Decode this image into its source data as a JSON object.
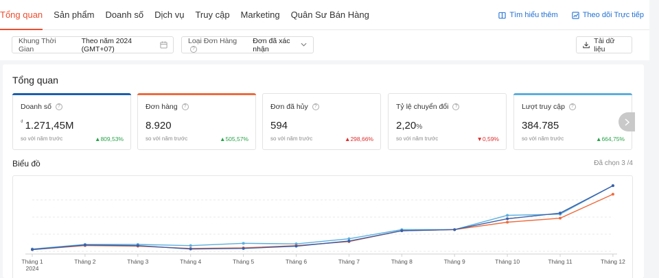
{
  "nav": {
    "tabs": [
      "Tổng quan",
      "Sản phẩm",
      "Doanh số",
      "Dịch vụ",
      "Truy cập",
      "Marketing",
      "Quân Sư Bán Hàng"
    ],
    "active_tab": 0,
    "learn_more": "Tìm hiểu thêm",
    "realtime": "Theo dõi Trực tiếp"
  },
  "filters": {
    "time_label": "Khung Thời Gian",
    "time_value": "Theo năm  2024 (GMT+07)",
    "order_label": "Loại Đơn Hàng",
    "order_value": "Đơn đã xác nhận",
    "download": "Tải dữ liệu"
  },
  "overview": {
    "title": "Tổng quan",
    "compare_text": "so với năm trước",
    "kpis": [
      {
        "name": "Doanh số",
        "currency": "₫",
        "value": "1.271,45M",
        "delta": "809,53%",
        "direction": "up",
        "color": "#1b5fb0"
      },
      {
        "name": "Đơn hàng",
        "value": "8.920",
        "delta": "505,57%",
        "direction": "up",
        "color": "#ee6a3c"
      },
      {
        "name": "Đơn đã hủy",
        "value": "594",
        "delta": "298,66%",
        "direction": "up",
        "color": ""
      },
      {
        "name": "Tỷ lệ chuyển đổi",
        "value": "2,20",
        "unit": "%",
        "delta": "0,59%",
        "direction": "down",
        "color": ""
      },
      {
        "name": "Lượt truy cập",
        "value": "384.785",
        "delta": "664,75%",
        "direction": "up",
        "color": "#5aaede"
      }
    ]
  },
  "chart_section": {
    "title": "Biểu đồ",
    "selected": "Đã chọn 3 /4"
  },
  "chart_data": {
    "type": "line",
    "categories": [
      "Tháng 1",
      "Tháng 2",
      "Tháng 3",
      "Tháng 4",
      "Tháng 5",
      "Tháng 6",
      "Tháng 7",
      "Tháng 8",
      "Tháng 9",
      "Tháng 10",
      "Tháng 11",
      "Tháng 12"
    ],
    "category_sublabel": {
      "0": "2024"
    },
    "grid": true,
    "legend": "none",
    "series": [
      {
        "color": "#5aaede",
        "values": [
          4,
          12,
          12,
          10,
          14,
          13,
          22,
          38,
          38,
          63,
          65,
          115
        ]
      },
      {
        "color": "#ee6a3c",
        "values": [
          3,
          10,
          9,
          5,
          6,
          10,
          17,
          36,
          38,
          51,
          58,
          100
        ]
      },
      {
        "color": "#3a5fa8",
        "values": [
          3,
          11,
          10,
          4,
          5,
          9,
          18,
          36,
          38,
          57,
          67,
          115
        ]
      }
    ]
  }
}
